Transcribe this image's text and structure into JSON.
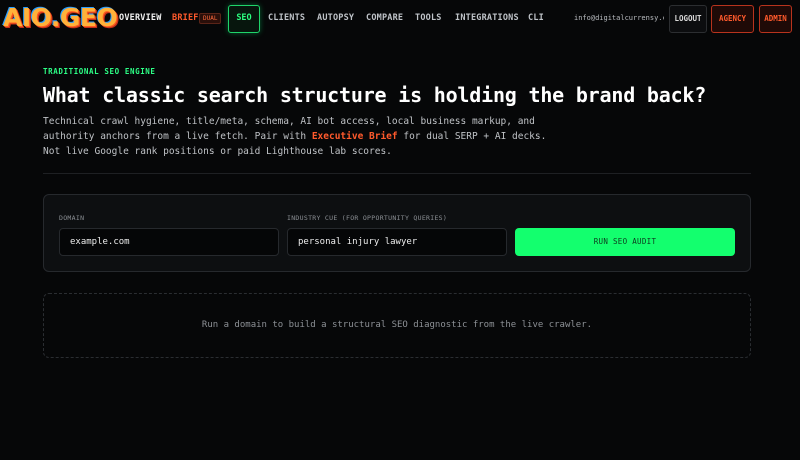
{
  "nav": {
    "logo": "AIO.GEO",
    "links": {
      "overview": "OVERVIEW",
      "brief": "BRIEF",
      "brief_badge": "DUAL",
      "seo": "SEO",
      "clients": "CLIENTS",
      "autopsy": "AUTOPSY",
      "compare": "COMPARE",
      "tools": "TOOLS",
      "integrations": "INTEGRATIONS",
      "cli": "CLI"
    },
    "email": "info@digitalcurrensy.c…",
    "logout": "LOGOUT",
    "agency": "AGENCY",
    "admin": "ADMIN"
  },
  "hero": {
    "eyebrow": "TRADITIONAL SEO ENGINE",
    "headline": "What classic search structure is holding the brand back?",
    "desc_part1": "Technical crawl hygiene, title/meta, schema, AI bot access, local business markup, and authority anchors from a live fetch. Pair with ",
    "desc_highlight": "Executive Brief",
    "desc_part2": " for dual SERP + AI decks. Not live Google rank positions or paid Lighthouse lab scores."
  },
  "form": {
    "domain_label": "DOMAIN",
    "domain_value": "example.com",
    "industry_label": "INDUSTRY CUE (FOR OPPORTUNITY QUERIES)",
    "industry_value": "personal injury lawyer",
    "submit_label": "RUN SEO AUDIT"
  },
  "empty_state": {
    "message": "Run a domain to build a structural SEO diagnostic from the live crawler."
  },
  "colors": {
    "accent_green": "#13ff6e",
    "accent_orange": "#ff5a2c",
    "background": "#060708"
  }
}
